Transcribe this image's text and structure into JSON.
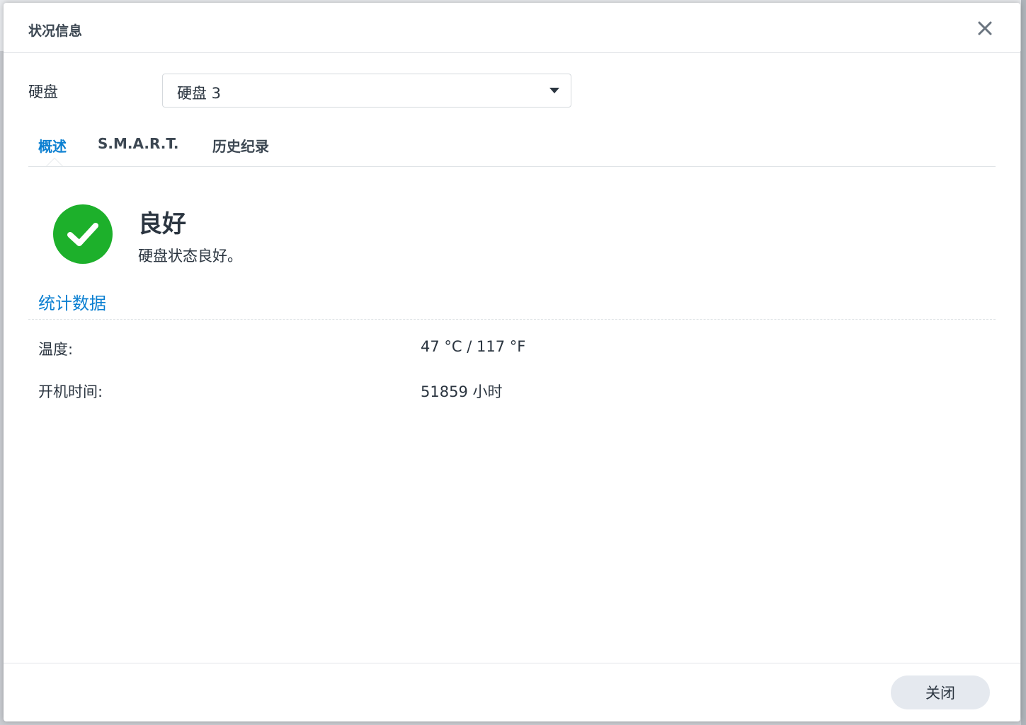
{
  "dialog": {
    "title": "状况信息",
    "close_icon": "close-icon"
  },
  "disk": {
    "label": "硬盘",
    "selected": "硬盘 3"
  },
  "tabs": [
    {
      "label": "概述",
      "active": true
    },
    {
      "label": "S.M.A.R.T.",
      "active": false
    },
    {
      "label": "历史纪录",
      "active": false
    }
  ],
  "status": {
    "icon": "check-circle-icon",
    "color": "#1db02b",
    "title": "良好",
    "description": "硬盘状态良好。"
  },
  "stats": {
    "heading": "统计数据",
    "rows": [
      {
        "label": "温度:",
        "value": "47 °C / 117 °F"
      },
      {
        "label": "开机时间:",
        "value": "51859 小时"
      }
    ]
  },
  "footer": {
    "close_label": "关闭"
  },
  "colors": {
    "accent": "#0a7fd1",
    "success": "#1db02b"
  }
}
